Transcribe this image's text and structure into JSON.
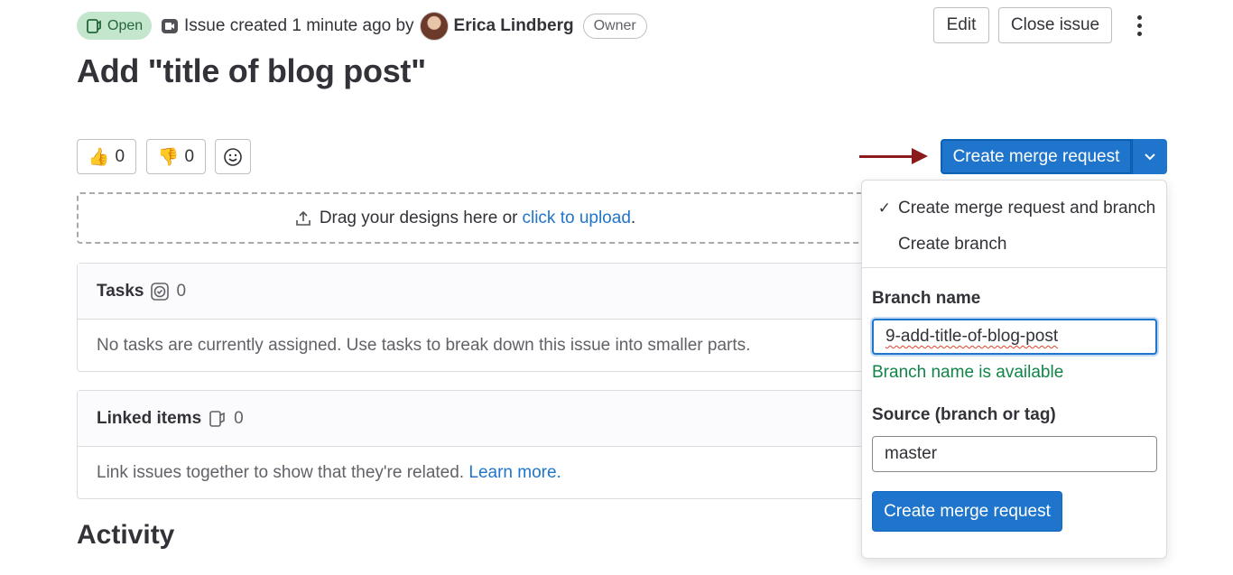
{
  "header": {
    "status": "Open",
    "created_text": "Issue created 1 minute ago by",
    "author": "Erica Lindberg",
    "role_badge": "Owner",
    "edit_label": "Edit",
    "close_label": "Close issue"
  },
  "issue": {
    "title": "Add \"title of blog post\""
  },
  "reactions": {
    "thumbs_up_count": "0",
    "thumbs_down_count": "0"
  },
  "merge_request": {
    "button_label": "Create merge request",
    "dropdown": {
      "options": [
        {
          "label": "Create merge request and branch",
          "selected": true
        },
        {
          "label": "Create branch",
          "selected": false
        }
      ],
      "branch_name_label": "Branch name",
      "branch_name_value": "9-add-title-of-blog-post",
      "branch_status": "Branch name is available",
      "source_label": "Source (branch or tag)",
      "source_value": "master",
      "submit_label": "Create merge request"
    }
  },
  "designs": {
    "prompt": "Drag your designs here or",
    "link": "click to upload",
    "suffix": "."
  },
  "tasks": {
    "title": "Tasks",
    "count": "0",
    "empty_text": "No tasks are currently assigned. Use tasks to break down this issue into smaller parts."
  },
  "linked_items": {
    "title": "Linked items",
    "count": "0",
    "empty_text": "Link issues together to show that they're related.",
    "learn_more": "Learn more."
  },
  "activity": {
    "heading": "Activity"
  },
  "colors": {
    "accent": "#1f75cb",
    "success": "#108548",
    "annotation_arrow": "#8b1a1a",
    "status_bg": "#c3e6cd"
  }
}
